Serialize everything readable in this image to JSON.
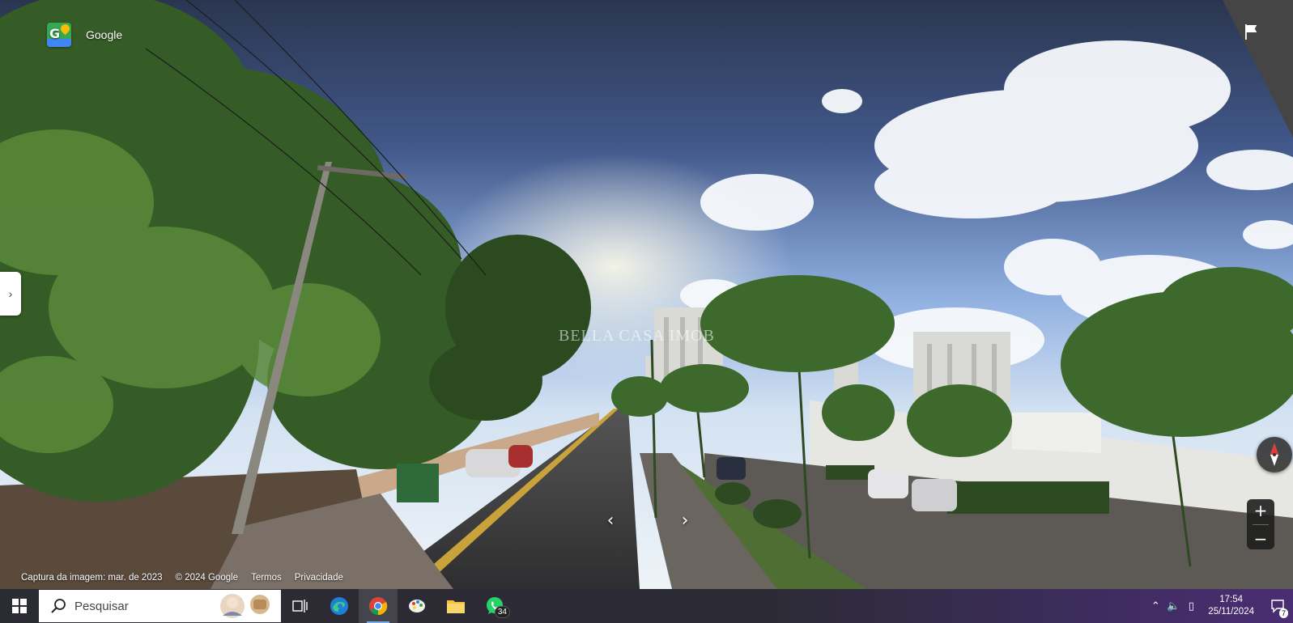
{
  "viewer": {
    "brand_label": "Google",
    "watermark": "BELLA CASA IMOB",
    "nav_prev": "‹",
    "nav_next": "›",
    "zoom_in": "+",
    "zoom_out": "−",
    "side_toggle": "›"
  },
  "attribution": {
    "capture_date": "Captura da imagem: mar. de 2023",
    "copyright": "© 2024 Google",
    "terms": "Termos",
    "privacy": "Privacidade"
  },
  "taskbar": {
    "search_placeholder": "Pesquisar",
    "apps": [
      {
        "name": "task-view",
        "icon": "task-view-icon"
      },
      {
        "name": "edge",
        "icon": "edge-icon"
      },
      {
        "name": "chrome",
        "icon": "chrome-icon",
        "active": true
      },
      {
        "name": "paint",
        "icon": "palette-icon"
      },
      {
        "name": "file-explorer",
        "icon": "folder-icon"
      },
      {
        "name": "whatsapp",
        "icon": "whatsapp-icon",
        "badge": "34"
      }
    ],
    "time": "17:54",
    "date": "25/11/2024",
    "notification_count": "7"
  },
  "colors": {
    "sky_top": "#2c3a55",
    "sky_mid": "#6f8fc4",
    "foliage": "#3f6b2f",
    "road": "#3a3a3c",
    "taskbar_accent": "#4a2d72"
  }
}
